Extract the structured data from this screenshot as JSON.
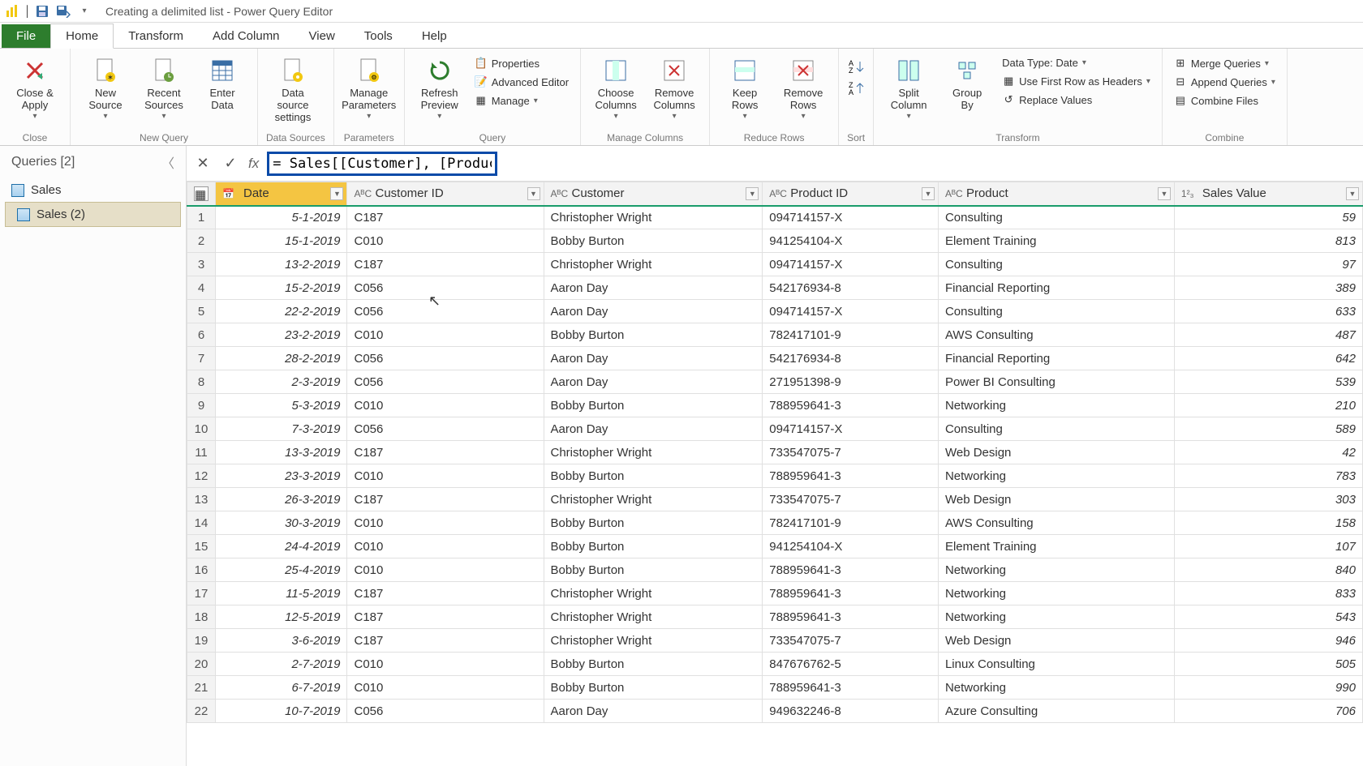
{
  "title": "Creating a delimited list - Power Query Editor",
  "tabs": {
    "file": "File",
    "home": "Home",
    "transform": "Transform",
    "addcol": "Add Column",
    "view": "View",
    "tools": "Tools",
    "help": "Help"
  },
  "ribbon": {
    "close_apply": "Close &\nApply",
    "new_source": "New\nSource",
    "recent_sources": "Recent\nSources",
    "enter_data": "Enter\nData",
    "ds_settings": "Data source\nsettings",
    "manage_params": "Manage\nParameters",
    "refresh": "Refresh\nPreview",
    "properties": "Properties",
    "adv_editor": "Advanced Editor",
    "manage": "Manage",
    "choose_cols": "Choose\nColumns",
    "remove_cols": "Remove\nColumns",
    "keep_rows": "Keep\nRows",
    "remove_rows": "Remove\nRows",
    "split_col": "Split\nColumn",
    "group_by": "Group\nBy",
    "data_type": "Data Type: Date",
    "first_row": "Use First Row as Headers",
    "replace": "Replace Values",
    "merge": "Merge Queries",
    "append": "Append Queries",
    "combine_files": "Combine Files",
    "g_close": "Close",
    "g_newquery": "New Query",
    "g_ds": "Data Sources",
    "g_params": "Parameters",
    "g_query": "Query",
    "g_mc": "Manage Columns",
    "g_rr": "Reduce Rows",
    "g_sort": "Sort",
    "g_transform": "Transform",
    "g_combine": "Combine"
  },
  "queries": {
    "header": "Queries [2]",
    "items": [
      "Sales",
      "Sales (2)"
    ],
    "selected": 1
  },
  "formula": "= Sales[[Customer], [Product]]",
  "columns": [
    {
      "name": "Date",
      "type": "date",
      "selected": true
    },
    {
      "name": "Customer ID",
      "type": "text"
    },
    {
      "name": "Customer",
      "type": "text"
    },
    {
      "name": "Product ID",
      "type": "text"
    },
    {
      "name": "Product",
      "type": "text"
    },
    {
      "name": "Sales Value",
      "type": "number"
    }
  ],
  "rows": [
    [
      "5-1-2019",
      "C187",
      "Christopher Wright",
      "094714157-X",
      "Consulting",
      "59"
    ],
    [
      "15-1-2019",
      "C010",
      "Bobby Burton",
      "941254104-X",
      "Element Training",
      "813"
    ],
    [
      "13-2-2019",
      "C187",
      "Christopher Wright",
      "094714157-X",
      "Consulting",
      "97"
    ],
    [
      "15-2-2019",
      "C056",
      "Aaron Day",
      "542176934-8",
      "Financial Reporting",
      "389"
    ],
    [
      "22-2-2019",
      "C056",
      "Aaron Day",
      "094714157-X",
      "Consulting",
      "633"
    ],
    [
      "23-2-2019",
      "C010",
      "Bobby Burton",
      "782417101-9",
      "AWS Consulting",
      "487"
    ],
    [
      "28-2-2019",
      "C056",
      "Aaron Day",
      "542176934-8",
      "Financial Reporting",
      "642"
    ],
    [
      "2-3-2019",
      "C056",
      "Aaron Day",
      "271951398-9",
      "Power BI Consulting",
      "539"
    ],
    [
      "5-3-2019",
      "C010",
      "Bobby Burton",
      "788959641-3",
      "Networking",
      "210"
    ],
    [
      "7-3-2019",
      "C056",
      "Aaron Day",
      "094714157-X",
      "Consulting",
      "589"
    ],
    [
      "13-3-2019",
      "C187",
      "Christopher Wright",
      "733547075-7",
      "Web Design",
      "42"
    ],
    [
      "23-3-2019",
      "C010",
      "Bobby Burton",
      "788959641-3",
      "Networking",
      "783"
    ],
    [
      "26-3-2019",
      "C187",
      "Christopher Wright",
      "733547075-7",
      "Web Design",
      "303"
    ],
    [
      "30-3-2019",
      "C010",
      "Bobby Burton",
      "782417101-9",
      "AWS Consulting",
      "158"
    ],
    [
      "24-4-2019",
      "C010",
      "Bobby Burton",
      "941254104-X",
      "Element Training",
      "107"
    ],
    [
      "25-4-2019",
      "C010",
      "Bobby Burton",
      "788959641-3",
      "Networking",
      "840"
    ],
    [
      "11-5-2019",
      "C187",
      "Christopher Wright",
      "788959641-3",
      "Networking",
      "833"
    ],
    [
      "12-5-2019",
      "C187",
      "Christopher Wright",
      "788959641-3",
      "Networking",
      "543"
    ],
    [
      "3-6-2019",
      "C187",
      "Christopher Wright",
      "733547075-7",
      "Web Design",
      "946"
    ],
    [
      "2-7-2019",
      "C010",
      "Bobby Burton",
      "847676762-5",
      "Linux Consulting",
      "505"
    ],
    [
      "6-7-2019",
      "C010",
      "Bobby Burton",
      "788959641-3",
      "Networking",
      "990"
    ],
    [
      "10-7-2019",
      "C056",
      "Aaron Day",
      "949632246-8",
      "Azure Consulting",
      "706"
    ]
  ],
  "type_glyphs": {
    "date": "📅",
    "text": "AᴮC",
    "number": "1²₃"
  }
}
